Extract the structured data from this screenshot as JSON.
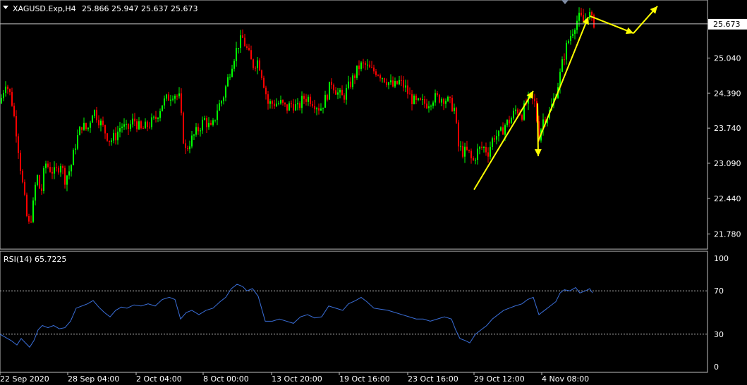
{
  "header": {
    "symbol": "XAGUSD.Exp,H4",
    "ohlc": "25.866 25.947 25.637 25.673"
  },
  "rsi_header": "RSI(14) 65.7225",
  "current_price": "25.673",
  "colors": {
    "background": "#000000",
    "bull_candle": "#00ff00",
    "bear_candle": "#ff0000",
    "rsi_line": "#3a6ed8",
    "annotation_arrows": "#ffff00",
    "grid_line": "#c0c0c0"
  },
  "chart_data": [
    {
      "type": "candlestick",
      "title": "XAGUSD.Exp,H4",
      "timeframe": "H4",
      "price_axis_ticks": [
        "25.673",
        "25.040",
        "24.390",
        "23.740",
        "23.090",
        "22.440",
        "21.780"
      ],
      "time_axis_ticks": [
        "22 Sep 2020",
        "28 Sep 04:00",
        "2 Oct 04:00",
        "8 Oct 00:00",
        "13 Oct 20:00",
        "19 Oct 16:00",
        "23 Oct 16:00",
        "29 Oct 12:00",
        "4 Nov 08:00"
      ],
      "ylim": [
        21.55,
        26.05
      ],
      "close_path": [
        [
          0,
          24.2
        ],
        [
          8,
          24.6
        ],
        [
          16,
          24.3
        ],
        [
          24,
          23.6
        ],
        [
          30,
          22.9
        ],
        [
          36,
          22.3
        ],
        [
          40,
          21.9
        ],
        [
          46,
          22.2
        ],
        [
          52,
          22.9
        ],
        [
          58,
          22.5
        ],
        [
          64,
          23.1
        ],
        [
          70,
          23.0
        ],
        [
          78,
          22.9
        ],
        [
          86,
          23.1
        ],
        [
          92,
          22.8
        ],
        [
          100,
          23.0
        ],
        [
          108,
          23.5
        ],
        [
          116,
          23.8
        ],
        [
          124,
          23.7
        ],
        [
          132,
          24.1
        ],
        [
          140,
          23.9
        ],
        [
          148,
          23.7
        ],
        [
          156,
          23.5
        ],
        [
          164,
          23.6
        ],
        [
          172,
          23.8
        ],
        [
          180,
          23.7
        ],
        [
          190,
          23.9
        ],
        [
          200,
          23.7
        ],
        [
          210,
          23.8
        ],
        [
          220,
          23.9
        ],
        [
          230,
          24.2
        ],
        [
          238,
          24.3
        ],
        [
          246,
          24.4
        ],
        [
          254,
          24.3
        ],
        [
          262,
          23.3
        ],
        [
          270,
          23.5
        ],
        [
          280,
          23.7
        ],
        [
          290,
          23.9
        ],
        [
          300,
          23.7
        ],
        [
          308,
          24.1
        ],
        [
          316,
          24.3
        ],
        [
          322,
          24.6
        ],
        [
          330,
          25.0
        ],
        [
          338,
          25.3
        ],
        [
          344,
          25.4
        ],
        [
          350,
          25.2
        ],
        [
          358,
          24.9
        ],
        [
          366,
          25.0
        ],
        [
          372,
          24.7
        ],
        [
          380,
          24.2
        ],
        [
          390,
          24.2
        ],
        [
          398,
          24.2
        ],
        [
          406,
          24.1
        ],
        [
          414,
          24.2
        ],
        [
          422,
          24.1
        ],
        [
          430,
          24.3
        ],
        [
          438,
          24.3
        ],
        [
          446,
          24.2
        ],
        [
          454,
          24.1
        ],
        [
          462,
          24.3
        ],
        [
          470,
          24.6
        ],
        [
          478,
          24.4
        ],
        [
          486,
          24.3
        ],
        [
          494,
          24.5
        ],
        [
          502,
          24.7
        ],
        [
          510,
          24.9
        ],
        [
          518,
          24.9
        ],
        [
          526,
          24.8
        ],
        [
          534,
          24.8
        ],
        [
          542,
          24.7
        ],
        [
          550,
          24.6
        ],
        [
          558,
          24.5
        ],
        [
          566,
          24.6
        ],
        [
          574,
          24.5
        ],
        [
          582,
          24.3
        ],
        [
          590,
          24.2
        ],
        [
          598,
          24.2
        ],
        [
          606,
          24.2
        ],
        [
          614,
          24.3
        ],
        [
          622,
          24.3
        ],
        [
          630,
          24.3
        ],
        [
          638,
          24.2
        ],
        [
          644,
          24.1
        ],
        [
          650,
          23.4
        ],
        [
          656,
          23.3
        ],
        [
          664,
          23.3
        ],
        [
          670,
          23.1
        ],
        [
          676,
          23.3
        ],
        [
          684,
          23.4
        ],
        [
          692,
          23.3
        ],
        [
          700,
          23.6
        ],
        [
          708,
          23.6
        ],
        [
          716,
          23.8
        ],
        [
          724,
          23.9
        ],
        [
          732,
          24.1
        ],
        [
          740,
          24.0
        ],
        [
          746,
          24.2
        ],
        [
          752,
          24.3
        ],
        [
          758,
          24.2
        ],
        [
          764,
          23.6
        ],
        [
          770,
          23.9
        ],
        [
          778,
          24.0
        ],
        [
          786,
          24.3
        ],
        [
          792,
          24.6
        ],
        [
          798,
          25.0
        ],
        [
          804,
          25.3
        ],
        [
          810,
          25.5
        ],
        [
          816,
          25.7
        ],
        [
          822,
          25.8
        ],
        [
          828,
          25.7
        ],
        [
          834,
          25.9
        ],
        [
          840,
          25.7
        ]
      ],
      "annotations": [
        {
          "type": "arrow",
          "from": [
            672,
            22.6
          ],
          "to": [
            756,
            24.43
          ]
        },
        {
          "type": "arrow",
          "from": [
            762,
            24.2
          ],
          "to": [
            763,
            23.22
          ]
        },
        {
          "type": "arrow",
          "from": [
            763,
            23.5
          ],
          "to": [
            834,
            25.8
          ]
        },
        {
          "type": "arrow",
          "from": [
            836,
            25.82
          ],
          "to": [
            898,
            25.5
          ]
        },
        {
          "type": "arrow",
          "from": [
            898,
            25.5
          ],
          "to": [
            932,
            26.0
          ]
        }
      ]
    },
    {
      "type": "line",
      "title": "RSI(14) 65.7225",
      "ylim": [
        0,
        100
      ],
      "y_ticks": [
        "100",
        "70",
        "30",
        "0"
      ],
      "levels": [
        70,
        30
      ],
      "series": [
        {
          "values": [
            [
              0,
              30
            ],
            [
              8,
              27
            ],
            [
              16,
              24
            ],
            [
              24,
              20
            ],
            [
              30,
              26
            ],
            [
              36,
              22
            ],
            [
              42,
              18
            ],
            [
              48,
              24
            ],
            [
              54,
              34
            ],
            [
              60,
              38
            ],
            [
              68,
              36
            ],
            [
              76,
              38
            ],
            [
              84,
              35
            ],
            [
              92,
              36
            ],
            [
              100,
              42
            ],
            [
              108,
              54
            ],
            [
              116,
              56
            ],
            [
              124,
              58
            ],
            [
              132,
              61
            ],
            [
              140,
              55
            ],
            [
              148,
              50
            ],
            [
              156,
              46
            ],
            [
              164,
              52
            ],
            [
              172,
              55
            ],
            [
              180,
              54
            ],
            [
              190,
              57
            ],
            [
              200,
              56
            ],
            [
              210,
              58
            ],
            [
              220,
              56
            ],
            [
              230,
              62
            ],
            [
              240,
              64
            ],
            [
              248,
              62
            ],
            [
              256,
              44
            ],
            [
              264,
              50
            ],
            [
              272,
              52
            ],
            [
              282,
              48
            ],
            [
              292,
              52
            ],
            [
              302,
              54
            ],
            [
              312,
              60
            ],
            [
              320,
              64
            ],
            [
              328,
              72
            ],
            [
              336,
              76
            ],
            [
              344,
              74
            ],
            [
              350,
              70
            ],
            [
              358,
              72
            ],
            [
              366,
              65
            ],
            [
              376,
              42
            ],
            [
              386,
              42
            ],
            [
              396,
              44
            ],
            [
              406,
              42
            ],
            [
              416,
              40
            ],
            [
              426,
              46
            ],
            [
              436,
              48
            ],
            [
              446,
              45
            ],
            [
              456,
              46
            ],
            [
              466,
              56
            ],
            [
              476,
              54
            ],
            [
              486,
              52
            ],
            [
              494,
              58
            ],
            [
              504,
              61
            ],
            [
              512,
              64
            ],
            [
              520,
              60
            ],
            [
              530,
              54
            ],
            [
              540,
              53
            ],
            [
              550,
              52
            ],
            [
              560,
              50
            ],
            [
              570,
              48
            ],
            [
              580,
              46
            ],
            [
              590,
              44
            ],
            [
              600,
              44
            ],
            [
              610,
              42
            ],
            [
              620,
              44
            ],
            [
              630,
              46
            ],
            [
              640,
              44
            ],
            [
              646,
              34
            ],
            [
              652,
              26
            ],
            [
              660,
              24
            ],
            [
              666,
              22
            ],
            [
              674,
              30
            ],
            [
              682,
              34
            ],
            [
              690,
              38
            ],
            [
              698,
              44
            ],
            [
              706,
              48
            ],
            [
              714,
              52
            ],
            [
              722,
              54
            ],
            [
              730,
              56
            ],
            [
              740,
              58
            ],
            [
              748,
              62
            ],
            [
              756,
              64
            ],
            [
              764,
              48
            ],
            [
              772,
              52
            ],
            [
              780,
              56
            ],
            [
              788,
              60
            ],
            [
              794,
              68
            ],
            [
              800,
              71
            ],
            [
              808,
              70
            ],
            [
              816,
              73
            ],
            [
              822,
              68
            ],
            [
              830,
              70
            ],
            [
              836,
              72
            ],
            [
              840,
              68
            ]
          ]
        }
      ]
    }
  ]
}
